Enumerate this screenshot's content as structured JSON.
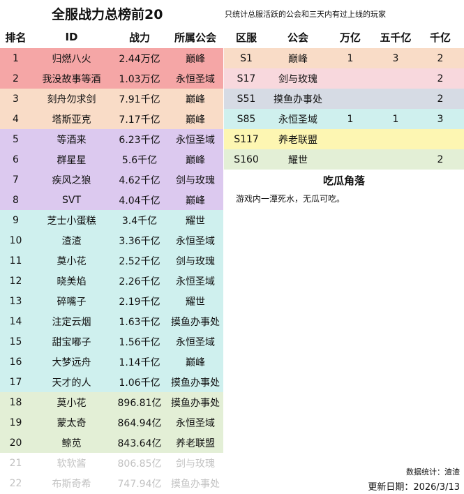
{
  "title": "全服战力总榜前20",
  "note": "只统计总服活跃的公会和三天内有过上线的玩家",
  "rank_headers": {
    "rank": "排名",
    "id": "ID",
    "power": "战力",
    "guild": "所属公会"
  },
  "server_headers": {
    "server": "区服",
    "guild": "公会",
    "wan": "万亿",
    "wuqian": "五千亿",
    "qian": "千亿"
  },
  "colors": {
    "red": "#f5a6a6",
    "peach": "#f9dcc7",
    "purple": "#dcc9ef",
    "teal": "#cff0ee",
    "green": "#e3efd6",
    "pink": "#f8d8dd",
    "slate": "#d6dbe4",
    "yellow": "#fdf6b2",
    "white": "#ffffff"
  },
  "rankings": [
    {
      "rank": "1",
      "id": "归燃八火",
      "power": "2.44万亿",
      "guild": "巅峰",
      "color": "#f5a6a6"
    },
    {
      "rank": "2",
      "id": "我没故事等酒",
      "power": "1.03万亿",
      "guild": "永恒圣域",
      "color": "#f5a6a6"
    },
    {
      "rank": "3",
      "id": "刻舟勿求剑",
      "power": "7.91千亿",
      "guild": "巅峰",
      "color": "#f9dcc7"
    },
    {
      "rank": "4",
      "id": "塔斯亚克",
      "power": "7.17千亿",
      "guild": "巅峰",
      "color": "#f9dcc7"
    },
    {
      "rank": "5",
      "id": "等酒来",
      "power": "6.23千亿",
      "guild": "永恒圣域",
      "color": "#dcc9ef"
    },
    {
      "rank": "6",
      "id": "群星星",
      "power": "5.6千亿",
      "guild": "巅峰",
      "color": "#dcc9ef"
    },
    {
      "rank": "7",
      "id": "疾风之狼",
      "power": "4.62千亿",
      "guild": "剑与玫瑰",
      "color": "#dcc9ef"
    },
    {
      "rank": "8",
      "id": "SVT",
      "power": "4.04千亿",
      "guild": "巅峰",
      "color": "#dcc9ef"
    },
    {
      "rank": "9",
      "id": "芝士小蛋糕",
      "power": "3.4千亿",
      "guild": "耀世",
      "color": "#cff0ee"
    },
    {
      "rank": "10",
      "id": "渣渣",
      "power": "3.36千亿",
      "guild": "永恒圣域",
      "color": "#cff0ee"
    },
    {
      "rank": "11",
      "id": "莫小花",
      "power": "2.52千亿",
      "guild": "剑与玫瑰",
      "color": "#cff0ee"
    },
    {
      "rank": "12",
      "id": "晓美焰",
      "power": "2.26千亿",
      "guild": "永恒圣域",
      "color": "#cff0ee"
    },
    {
      "rank": "13",
      "id": "碎嘴子",
      "power": "2.19千亿",
      "guild": "耀世",
      "color": "#cff0ee"
    },
    {
      "rank": "14",
      "id": "注定云烟",
      "power": "1.63千亿",
      "guild": "摸鱼办事处",
      "color": "#cff0ee"
    },
    {
      "rank": "15",
      "id": "甜宝嘟子",
      "power": "1.56千亿",
      "guild": "永恒圣域",
      "color": "#cff0ee"
    },
    {
      "rank": "16",
      "id": "大梦远舟",
      "power": "1.14千亿",
      "guild": "巅峰",
      "color": "#cff0ee"
    },
    {
      "rank": "17",
      "id": "天才的人",
      "power": "1.06千亿",
      "guild": "摸鱼办事处",
      "color": "#cff0ee"
    },
    {
      "rank": "18",
      "id": "莫小花",
      "power": "896.81亿",
      "guild": "摸鱼办事处",
      "color": "#e3efd6"
    },
    {
      "rank": "19",
      "id": "蒙太奇",
      "power": "864.94亿",
      "guild": "永恒圣域",
      "color": "#e3efd6"
    },
    {
      "rank": "20",
      "id": "鲸苋",
      "power": "843.64亿",
      "guild": "养老联盟",
      "color": "#e3efd6"
    },
    {
      "rank": "21",
      "id": "软软酱",
      "power": "806.85亿",
      "guild": "剑与玫瑰",
      "color": "#ffffff",
      "muted": true
    },
    {
      "rank": "22",
      "id": "布斯奇希",
      "power": "747.94亿",
      "guild": "摸鱼办事处",
      "color": "#ffffff",
      "muted": true
    }
  ],
  "servers": [
    {
      "server": "S1",
      "guild": "巅峰",
      "wan": "1",
      "wuqian": "3",
      "qian": "2",
      "color": "#f9dcc7"
    },
    {
      "server": "S17",
      "guild": "剑与玫瑰",
      "wan": "",
      "wuqian": "",
      "qian": "2",
      "color": "#f8d8dd"
    },
    {
      "server": "S51",
      "guild": "摸鱼办事处",
      "wan": "",
      "wuqian": "",
      "qian": "2",
      "color": "#d6dbe4"
    },
    {
      "server": "S85",
      "guild": "永恒圣域",
      "wan": "1",
      "wuqian": "1",
      "qian": "3",
      "color": "#cff0ee"
    },
    {
      "server": "S117",
      "guild": "养老联盟",
      "wan": "",
      "wuqian": "",
      "qian": "",
      "color": "#fdf6b2"
    },
    {
      "server": "S160",
      "guild": "耀世",
      "wan": "",
      "wuqian": "",
      "qian": "2",
      "color": "#e3efd6"
    }
  ],
  "gossip": {
    "title": "吃瓜角落",
    "text": "游戏内一潭死水，无瓜可吃。"
  },
  "footer": {
    "stat": "数据统计：渣渣",
    "update": "更新日期：2026/3/13"
  }
}
